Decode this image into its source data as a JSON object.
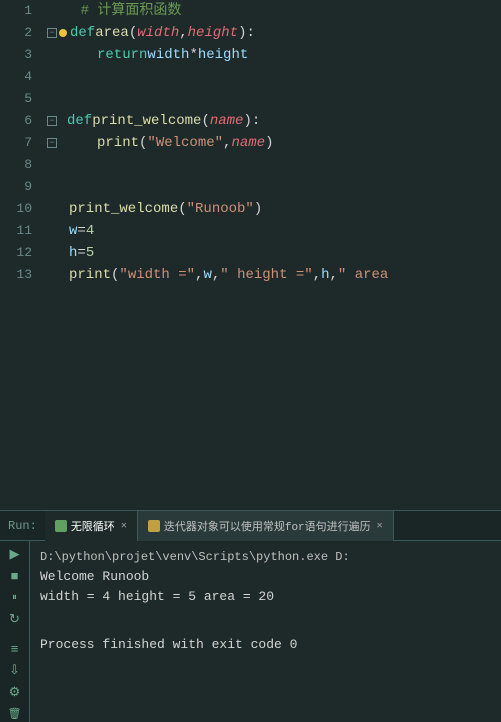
{
  "editor": {
    "lines": [
      {
        "num": "1",
        "type": "comment",
        "content": "# 计算面积函数"
      },
      {
        "num": "2",
        "type": "def_area",
        "content": "def area(width, height):"
      },
      {
        "num": "3",
        "type": "return",
        "content": "    return width * height"
      },
      {
        "num": "4",
        "type": "empty"
      },
      {
        "num": "5",
        "type": "empty"
      },
      {
        "num": "6",
        "type": "def_welcome",
        "content": "def print_welcome(name):"
      },
      {
        "num": "7",
        "type": "print_name",
        "content": "    print(\"Welcome\", name)"
      },
      {
        "num": "8",
        "type": "empty"
      },
      {
        "num": "9",
        "type": "empty"
      },
      {
        "num": "10",
        "type": "call_welcome",
        "content": "print_welcome(\"Runoob\")"
      },
      {
        "num": "11",
        "type": "assign_w",
        "content": "w = 4"
      },
      {
        "num": "12",
        "type": "assign_h",
        "content": "h = 5"
      },
      {
        "num": "13",
        "type": "print_all",
        "content": "print(\"width =\", w, \" height =\", h, \" area"
      }
    ]
  },
  "panel": {
    "run_label": "Run:",
    "tabs": [
      {
        "label": "无限循环",
        "icon": "loop",
        "active": true,
        "closable": true
      },
      {
        "label": "迭代器对象可以使用常规for语句进行遍历",
        "icon": "iter",
        "active": false,
        "closable": true
      }
    ],
    "output": [
      {
        "text": "D:\\python\\projet\\venv\\Scripts\\python.exe D:"
      },
      {
        "text": "Welcome Runoob"
      },
      {
        "text": "width = 4  height = 5  area = 20"
      },
      {
        "text": ""
      },
      {
        "text": "Process finished with exit code 0"
      }
    ]
  },
  "buttons": {
    "play": "▶",
    "stop": "■",
    "pause": "⏸",
    "rerun": "↻",
    "scroll_up": "▲",
    "scroll_down": "▼",
    "settings": "⚙",
    "trash": "🗑"
  }
}
